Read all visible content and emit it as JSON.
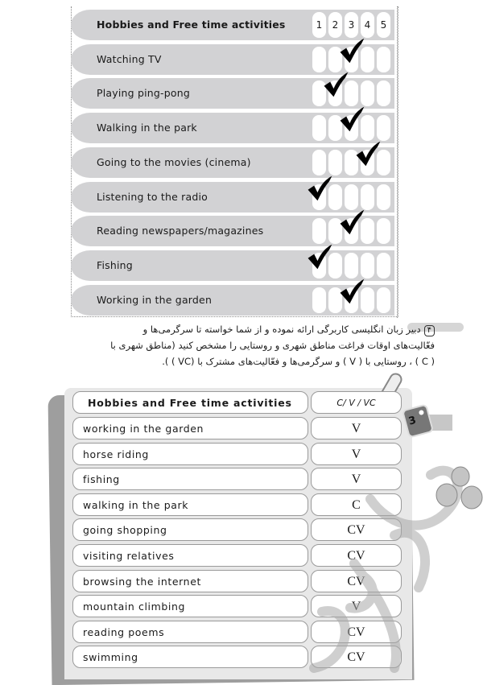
{
  "rating_table": {
    "header_label": "Hobbies and Free time activities",
    "scale": [
      "1",
      "2",
      "3",
      "4",
      "5"
    ],
    "rows": [
      {
        "label": "Watching TV",
        "checked": 3
      },
      {
        "label": "Playing ping-pong",
        "checked": 2
      },
      {
        "label": "Walking in the park",
        "checked": 3
      },
      {
        "label": "Going to the movies (cinema)",
        "checked": 4
      },
      {
        "label": "Listening to the radio",
        "checked": 1
      },
      {
        "label": "Reading newspapers/magazines",
        "checked": 3
      },
      {
        "label": "Fishing",
        "checked": 1
      },
      {
        "label": "Working in the garden",
        "checked": 3
      }
    ]
  },
  "instruction": {
    "number": "۴",
    "line1": "دبیر زبان انگلیسی کاربرگی ارائه نموده و از شما خواسته تا سرگرمی‌ها و",
    "line2": "فعّالیت‌های اوقات فراغت مناطق شهری و روستایی را مشخص کنید (مناطق شهری با",
    "line3": "( C ) ، روستایی با ( V ) و سرگرمی‌ها و فعّالیت‌های مشترک با (VC ) )."
  },
  "classification_table": {
    "header_activity": "Hobbies and Free time activities",
    "header_code": "C/ V / VC",
    "rows": [
      {
        "activity": "working in the garden",
        "code": "V"
      },
      {
        "activity": "horse riding",
        "code": "V"
      },
      {
        "activity": "fishing",
        "code": "V"
      },
      {
        "activity": "walking in the park",
        "code": "C"
      },
      {
        "activity": "going shopping",
        "code": "CV"
      },
      {
        "activity": "visiting relatives",
        "code": "CV"
      },
      {
        "activity": "browsing the internet",
        "code": "CV"
      },
      {
        "activity": "mountain climbing",
        "code": "V"
      },
      {
        "activity": "reading poems",
        "code": "CV"
      },
      {
        "activity": "swimming",
        "code": "CV"
      }
    ]
  },
  "side_tab": {
    "label": "3"
  },
  "icons": {
    "check": "checkmark-icon",
    "clip": "paperclip-icon",
    "watermark": "watermark-logo"
  }
}
